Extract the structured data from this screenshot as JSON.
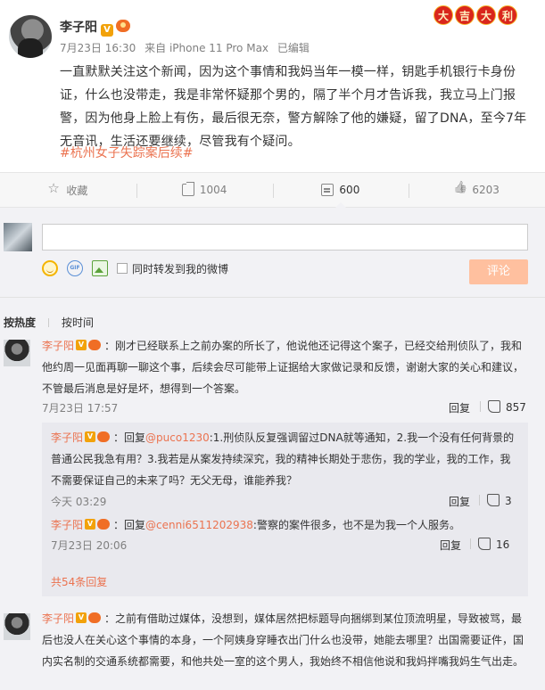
{
  "post": {
    "author": "李子阳",
    "vip_badge": "V",
    "time": "7月23日 16:30",
    "source": "来自 iPhone 11 Pro Max",
    "edited": "已编辑",
    "text": "一直默默关注这个新闻，因为这个事情和我妈当年一模一样，钥匙手机银行卡身份证，什么也没带走，我是非常怀疑那个男的，隔了半个月才告诉我，我立马上门报警，因为他身上脸上有伤，最后很无奈，警方解除了他的嫌疑，留了DNA，至今7年无音讯，生活还要继续，尽管我有个疑问。",
    "hashtag": "#杭州女子失踪案后续#",
    "badge_chars": [
      "大",
      "吉",
      "大",
      "利"
    ]
  },
  "actions": {
    "favorite": "收藏",
    "repost_count": "1004",
    "comment_count": "600",
    "like_count": "6203"
  },
  "composer": {
    "input_value": "",
    "gif_label": "GIF",
    "repost_checkbox_label": "同时转发到我的微博",
    "submit_label": "评论"
  },
  "sort": {
    "by_hot": "按热度",
    "by_time": "按时间"
  },
  "comments": [
    {
      "author": "李子阳",
      "text": "：刚才已经联系上之前办案的所长了，他说他还记得这个案子，已经交给刑侦队了，我和他约周一见面再聊一聊这个事，后续会尽可能带上证据给大家做记录和反馈，谢谢大家的关心和建议，不管最后消息是好是坏，想得到一个答案。",
      "time": "7月23日 17:57",
      "reply_label": "回复",
      "likes": "857",
      "sub_replies": [
        {
          "author": "李子阳",
          "prefix": "：回复",
          "at": "@puco1230",
          "text": ":1.刑侦队反复强调留过DNA就等通知，2.我一个没有任何背景的普通公民我急有用？3.我若是从案发持续深究，我的精神长期处于悲伤，我的学业，我的工作，我不需要保证自己的未来了吗？无父无母，谁能养我？",
          "time": "今天 03:29",
          "reply_label": "回复",
          "likes": "3"
        },
        {
          "author": "李子阳",
          "prefix": "：回复",
          "at": "@cenni6511202938",
          "text": ":警察的案件很多，也不是为我一个人服务。",
          "time": "7月23日 20:06",
          "reply_label": "回复",
          "likes": "16"
        }
      ],
      "more_replies": "共54条回复"
    },
    {
      "author": "李子阳",
      "text": "：之前有借助过媒体，没想到，媒体居然把标题导向捆绑到某位顶流明星，导致被骂，最后也没人在关心这个事情的本身，一个阿姨身穿睡衣出门什么也没带，她能去哪里？出国需要证件，国内实名制的交通系统都需要，和他共处一室的这个男人，我始终不相信他说和我妈拌嘴我妈生气出走。"
    }
  ]
}
